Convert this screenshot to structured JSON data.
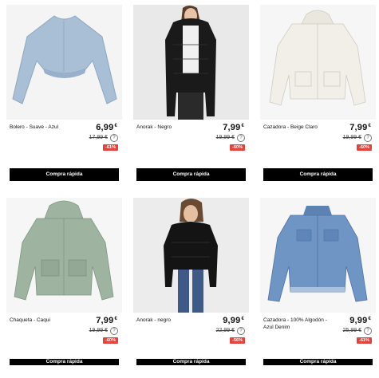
{
  "products": [
    {
      "name": "Bolero - Suave - Azul",
      "price": "6,99",
      "currency": "€",
      "old_price": "17,99 €",
      "discount": "-61%",
      "buy_label": "Compra rápida",
      "color": "#a9bfd6"
    },
    {
      "name": "Anorak - Negro",
      "price": "7,99",
      "currency": "€",
      "old_price": "19,99 €",
      "discount": "-60%",
      "buy_label": "Compra rápida",
      "color": "#1a1a1a"
    },
    {
      "name": "Cazadora - Beige Claro",
      "price": "7,99",
      "currency": "€",
      "old_price": "19,99 €",
      "discount": "-60%",
      "buy_label": "Compra rápida",
      "color": "#f1efe8"
    },
    {
      "name": "Chaqueta - Caqui",
      "price": "7,99",
      "currency": "€",
      "old_price": "19,99 €",
      "discount": "-60%",
      "buy_label": "Compra rápida",
      "color": "#9fb3a1"
    },
    {
      "name": "Anorak - negro",
      "price": "9,99",
      "currency": "€",
      "old_price": "22,99 €",
      "discount": "-56%",
      "buy_label": "Compra rápida",
      "color": "#141414"
    },
    {
      "name": "Cazadora - 100% Algodón - Azul Denim",
      "price": "9,99",
      "currency": "€",
      "old_price": "25,99 €",
      "discount": "-61%",
      "buy_label": "Compra rápida",
      "color": "#6f95c4"
    }
  ],
  "info_icon": "question-circle-icon"
}
